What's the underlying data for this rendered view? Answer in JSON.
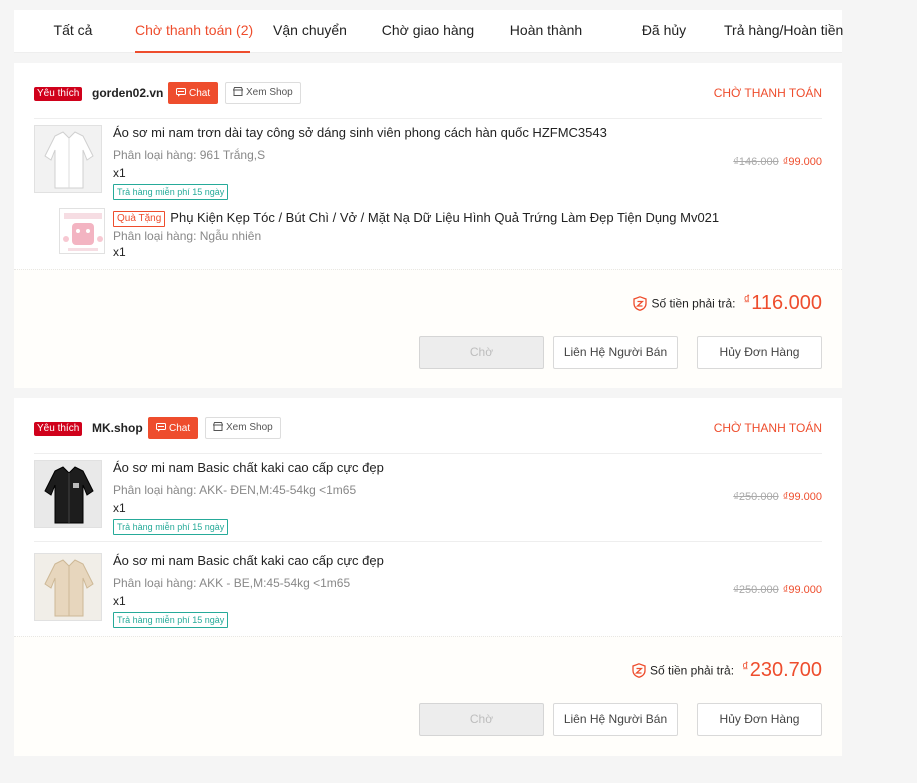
{
  "tabs": [
    {
      "label": "Tất cả"
    },
    {
      "label": "Chờ thanh toán (2)"
    },
    {
      "label": "Vận chuyển"
    },
    {
      "label": "Chờ giao hàng"
    },
    {
      "label": "Hoàn thành"
    },
    {
      "label": "Đã hủy"
    },
    {
      "label": "Trả hàng/Hoàn tiền"
    }
  ],
  "active_tab": "Chờ thanh toán (2)",
  "colors": {
    "accent": "#ee4d2d",
    "favorite_badge": "#d0011b",
    "return_tag": "#26aa99"
  },
  "common": {
    "favorite_badge": "Yêu thích",
    "chat_label": "Chat",
    "view_shop_label": "Xem Shop",
    "status": "CHỜ THANH TOÁN",
    "return_tag": "Trả hàng miễn phí 15 ngày",
    "gift_tag": "Quà Tặng",
    "total_label": "Số tiền phải trả:",
    "currency_symbol": "₫",
    "wait_button": "Chờ",
    "contact_seller_button": "Liên Hệ Người Bán",
    "cancel_order_button": "Hủy Đơn Hàng"
  },
  "orders": [
    {
      "shop_name": "gorden02.vn",
      "items": [
        {
          "name": "Áo sơ mi nam trơn dài tay công sở dáng sinh viên phong cách hàn quốc HZFMC3543",
          "variant": "Phân loại hàng: 961 Trắng,S",
          "qty": "x1",
          "old_price": "₫146.000",
          "new_price": "₫99.000",
          "image": "white-shirt"
        }
      ],
      "gift": {
        "name": "Phụ Kiện Kẹp Tóc / Bút Chì / Vở / Mặt Nạ Dữ Liệu Hình Quả Trứng Làm Đẹp Tiện Dụng Mv021",
        "variant": "Phân loại hàng: Ngẫu nhiên",
        "qty": "x1",
        "image": "gift-product"
      },
      "total": "116.000"
    },
    {
      "shop_name": "MK.shop",
      "items": [
        {
          "name": "Áo sơ mi nam Basic chất kaki cao cấp cực đẹp",
          "variant": "Phân loại hàng: AKK- ĐEN,M:45-54kg <1m65",
          "qty": "x1",
          "old_price": "₫250.000",
          "new_price": "₫99.000",
          "image": "black-shirt"
        },
        {
          "name": "Áo sơ mi nam Basic chất kaki cao cấp cực đẹp",
          "variant": "Phân loại hàng: AKK - BE,M:45-54kg <1m65",
          "qty": "x1",
          "old_price": "₫250.000",
          "new_price": "₫99.000",
          "image": "beige-shirt"
        }
      ],
      "total": "230.700"
    }
  ]
}
